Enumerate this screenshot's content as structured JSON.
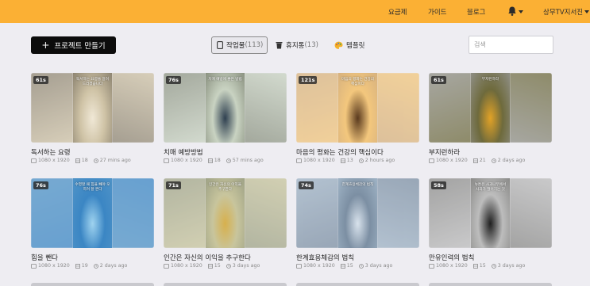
{
  "nav": {
    "pricing": "요금제",
    "guide": "가이드",
    "blog": "블로그",
    "user": "상무TV지서진"
  },
  "toolbar": {
    "new_project": "프로젝트 만들기",
    "tabs": [
      {
        "label": "작업물",
        "count": "(113)"
      },
      {
        "label": "휴지통",
        "count": "(13)"
      },
      {
        "label": "템플릿",
        "count": ""
      }
    ],
    "search_placeholder": "검색"
  },
  "colors": {
    "topbar": "#fbb034",
    "accent_button": "#0c0c0c",
    "background": "#eeedf2"
  },
  "cards": [
    {
      "duration": "61s",
      "title": "독서하는 요령",
      "resolution": "1080 x 1920",
      "scenes": "18",
      "time": "27 mins ago",
      "caption": "독서하는 요령을 알려드리겠습니다",
      "palette": [
        "#8d8471",
        "#cfc3a6",
        "#f0e8d6"
      ]
    },
    {
      "duration": "76s",
      "title": "치매 예방방법",
      "resolution": "1080 x 1920",
      "scenes": "18",
      "time": "57 mins ago",
      "caption": "치매 예방에 좋은 방법",
      "palette": [
        "#8a9180",
        "#c9d3c2",
        "#2f4050"
      ]
    },
    {
      "duration": "121s",
      "title": "마음의 평화는 건강의 핵심이다",
      "resolution": "1080 x 1920",
      "scenes": "13",
      "time": "2 hours ago",
      "caption": "마음의 평화는 건강의 핵심이다",
      "palette": [
        "#d7b27f",
        "#f3c77d",
        "#5a3a1e"
      ]
    },
    {
      "duration": "61s",
      "title": "부지런하라",
      "resolution": "1080 x 1920",
      "scenes": "21",
      "time": "2 days ago",
      "caption": "부지런하라",
      "palette": [
        "#8f8f86",
        "#6e6a3c",
        "#e1a227"
      ]
    },
    {
      "duration": "76s",
      "title": "힘을 뺀다",
      "resolution": "1080 x 1920",
      "scenes": "19",
      "time": "2 days ago",
      "caption": "수영할 때 힘을 빼야 오히려 잘 뜬다",
      "palette": [
        "#4f93c7",
        "#3b86c4",
        "#9fd3ef"
      ]
    },
    {
      "duration": "71s",
      "title": "인간은 자신의 이익을 추구한다",
      "resolution": "1080 x 1920",
      "scenes": "15",
      "time": "3 days ago",
      "caption": "인간은 자신의 이익을 추구한다",
      "palette": [
        "#9ea286",
        "#c8c59d",
        "#d7b04d"
      ]
    },
    {
      "duration": "74s",
      "title": "한계효용체감의 법칙",
      "resolution": "1080 x 1920",
      "scenes": "15",
      "time": "3 days ago",
      "caption": "한계효용체감의 법칙",
      "palette": [
        "#9fb3c5",
        "#7c8fa3",
        "#d8e2ec"
      ]
    },
    {
      "duration": "58s",
      "title": "만유인력의 법칙",
      "resolution": "1080 x 1920",
      "scenes": "15",
      "time": "3 days ago",
      "caption": "뉴튼은 사과나무에서 사과가 떨어지는 것",
      "palette": [
        "#8a8a88",
        "#bdbdbd",
        "#1f1f1f"
      ]
    }
  ]
}
